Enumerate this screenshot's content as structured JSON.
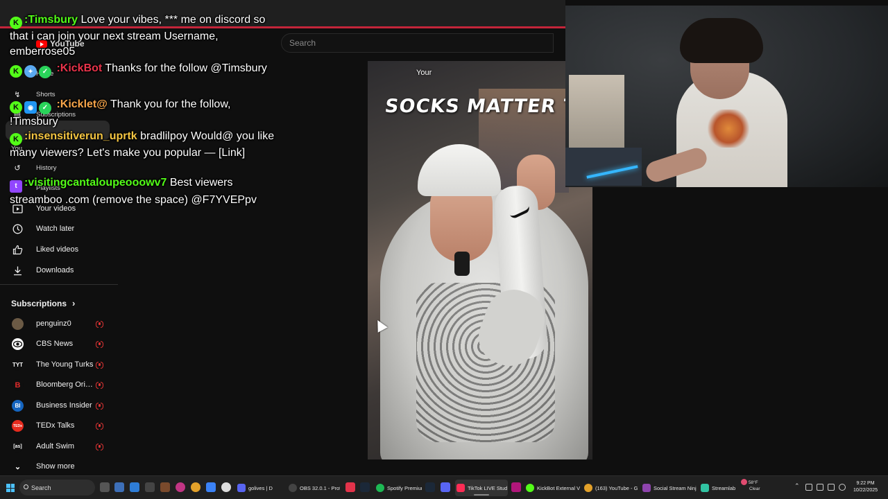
{
  "youtube": {
    "logo_text": "YouTube",
    "search_placeholder": "Search",
    "nav": [
      {
        "label": "Home",
        "icon": "home-icon"
      },
      {
        "label": "Shorts",
        "icon": "shorts-icon"
      },
      {
        "label": "Subscriptions",
        "icon": "subscriptions-icon"
      },
      {
        "label": "You",
        "icon": "you-icon"
      },
      {
        "label": "History",
        "icon": "history-icon"
      },
      {
        "label": "Playlists",
        "icon": "playlists-icon"
      },
      {
        "label": "Your videos",
        "icon": "your-videos-icon"
      },
      {
        "label": "Watch later",
        "icon": "watch-later-icon"
      },
      {
        "label": "Liked videos",
        "icon": "liked-icon"
      },
      {
        "label": "Downloads",
        "icon": "download-icon"
      }
    ],
    "subscriptions_heading": "Subscriptions",
    "subscriptions": [
      {
        "name": "penguinz0",
        "avatar_color": "#6b5a45",
        "avatar_text": ""
      },
      {
        "name": "CBS News",
        "avatar_color": "#ffffff",
        "avatar_text": ""
      },
      {
        "name": "The Young Turks",
        "avatar_color": "#0f0f0f",
        "avatar_text": "TYT"
      },
      {
        "name": "Bloomberg Origi...",
        "avatar_color": "#0f0f0f",
        "avatar_text": "B"
      },
      {
        "name": "Business Insider",
        "avatar_color": "#1565c0",
        "avatar_text": "BI"
      },
      {
        "name": "TEDx Talks",
        "avatar_color": "#e62b1e",
        "avatar_text": "TEDx"
      },
      {
        "name": "Adult Swim",
        "avatar_color": "#0f0f0f",
        "avatar_text": "[as]"
      }
    ],
    "show_more": "Show more",
    "video": {
      "caption": "SOCKS MATTER TOO",
      "tag": "Your"
    }
  },
  "chat": [
    {
      "user": ":Timsbury",
      "user_color": "#53fc18",
      "badges": [
        "kick"
      ],
      "text": "Love your vibes, *** me on discord so that i can join your next stream Username, emberrose05"
    },
    {
      "user": ":KickBot",
      "user_color": "#e8334a",
      "badges": [
        "kick",
        "bot",
        "verify"
      ],
      "text": "Thanks for the follow @Timsbury"
    },
    {
      "user": ":Kicklet@",
      "user_color": "#f7a54a",
      "badges": [
        "kick",
        "blue",
        "verify"
      ],
      "text": "Thank you for the follow, !Timsbury"
    },
    {
      "user": ":insensitiverun_uprtk",
      "user_color": "#f4c542",
      "badges": [
        "kick"
      ],
      "text": "bradlilpoy Would@ you like many viewers? Let's make you popular — [Link]"
    },
    {
      "user": ":visitingcantaloupeooowv7",
      "user_color": "#53fc18",
      "badges": [
        "twitch"
      ],
      "text": "Best viewers streamboo .com (remove the space) @F7YVEPpv"
    }
  ],
  "taskbar": {
    "search_label": "Search",
    "apps": [
      {
        "label": "golives | D",
        "color": "#5865f2"
      },
      {
        "label": "OBS 32.0.1 - Profil",
        "color": "#444444"
      },
      {
        "label": "Spotify Premium",
        "color": "#1db954"
      },
      {
        "label": "TikTok LIVE Stud",
        "color": "#fe2c55"
      },
      {
        "label": "KickBot External V",
        "color": "#53fc18"
      },
      {
        "label": "(163) YouTube - G",
        "color": "#ff0000"
      },
      {
        "label": "Social Stream Ninj",
        "color": "#8e44ad"
      },
      {
        "label": "Streamlab",
        "color": "#31c3a2"
      }
    ],
    "weather_temp": "58°F",
    "weather_cond": "Clear",
    "time": "9:22 PM",
    "date": "10/22/2025"
  }
}
